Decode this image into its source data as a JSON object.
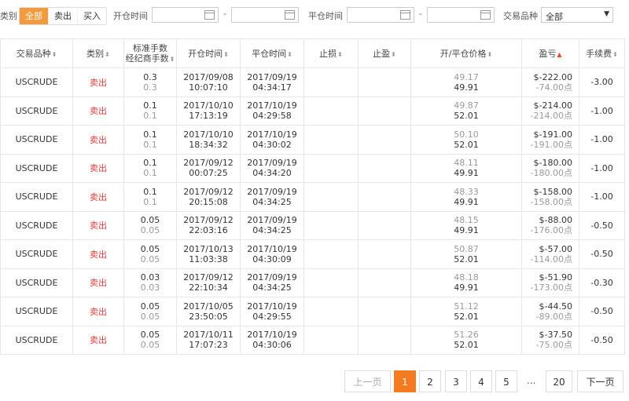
{
  "filters": {
    "type_label": "类别",
    "type_options": [
      "全部",
      "卖出",
      "买入"
    ],
    "open_time_label": "开仓时间",
    "close_time_label": "平仓时间",
    "date_separator": "-",
    "product_label": "交易品种",
    "product_selected": "全部",
    "select_arrow": "▼"
  },
  "table": {
    "headers": {
      "product": "交易品种",
      "type": "类别",
      "lots_line1": "标准手数",
      "lots_line2": "经纪商手数",
      "open_time": "开仓时间",
      "close_time": "平仓时间",
      "stop_loss": "止损",
      "take_profit": "止盈",
      "price": "开/平仓价格",
      "pnl": "盈亏",
      "fee": "手续费"
    },
    "rows": [
      {
        "product": "USCRUDE",
        "type": "卖出",
        "lots": "0.3",
        "broker_lots": "0.3",
        "open_date": "2017/09/08",
        "open_clock": "10:07:10",
        "close_date": "2017/09/19",
        "close_clock": "04:34:17",
        "sl": "",
        "tp": "",
        "open_price": "49.17",
        "close_price": "49.91",
        "pnl": "$-222.00",
        "pnl_points": "-74.00点",
        "fee": "-3.00"
      },
      {
        "product": "USCRUDE",
        "type": "卖出",
        "lots": "0.1",
        "broker_lots": "0.1",
        "open_date": "2017/10/10",
        "open_clock": "17:13:19",
        "close_date": "2017/10/19",
        "close_clock": "04:29:58",
        "sl": "",
        "tp": "",
        "open_price": "49.87",
        "close_price": "52.01",
        "pnl": "$-214.00",
        "pnl_points": "-214.00点",
        "fee": "-1.00"
      },
      {
        "product": "USCRUDE",
        "type": "卖出",
        "lots": "0.1",
        "broker_lots": "0.1",
        "open_date": "2017/10/10",
        "open_clock": "18:34:32",
        "close_date": "2017/10/19",
        "close_clock": "04:30:02",
        "sl": "",
        "tp": "",
        "open_price": "50.10",
        "close_price": "52.01",
        "pnl": "$-191.00",
        "pnl_points": "-191.00点",
        "fee": "-1.00"
      },
      {
        "product": "USCRUDE",
        "type": "卖出",
        "lots": "0.1",
        "broker_lots": "0.1",
        "open_date": "2017/09/12",
        "open_clock": "00:07:25",
        "close_date": "2017/09/19",
        "close_clock": "04:34:20",
        "sl": "",
        "tp": "",
        "open_price": "48.11",
        "close_price": "49.91",
        "pnl": "$-180.00",
        "pnl_points": "-180.00点",
        "fee": "-1.00"
      },
      {
        "product": "USCRUDE",
        "type": "卖出",
        "lots": "0.1",
        "broker_lots": "0.1",
        "open_date": "2017/09/12",
        "open_clock": "20:15:08",
        "close_date": "2017/09/19",
        "close_clock": "04:34:25",
        "sl": "",
        "tp": "",
        "open_price": "48.33",
        "close_price": "49.91",
        "pnl": "$-158.00",
        "pnl_points": "-158.00点",
        "fee": "-1.00"
      },
      {
        "product": "USCRUDE",
        "type": "卖出",
        "lots": "0.05",
        "broker_lots": "0.05",
        "open_date": "2017/09/12",
        "open_clock": "22:03:16",
        "close_date": "2017/09/19",
        "close_clock": "04:34:25",
        "sl": "",
        "tp": "",
        "open_price": "48.15",
        "close_price": "49.91",
        "pnl": "$-88.00",
        "pnl_points": "-176.00点",
        "fee": "-0.50"
      },
      {
        "product": "USCRUDE",
        "type": "卖出",
        "lots": "0.05",
        "broker_lots": "0.05",
        "open_date": "2017/10/13",
        "open_clock": "11:03:38",
        "close_date": "2017/10/19",
        "close_clock": "04:30:09",
        "sl": "",
        "tp": "",
        "open_price": "50.87",
        "close_price": "52.01",
        "pnl": "$-57.00",
        "pnl_points": "-114.00点",
        "fee": "-0.50"
      },
      {
        "product": "USCRUDE",
        "type": "卖出",
        "lots": "0.03",
        "broker_lots": "0.03",
        "open_date": "2017/09/12",
        "open_clock": "22:10:34",
        "close_date": "2017/09/19",
        "close_clock": "04:34:25",
        "sl": "",
        "tp": "",
        "open_price": "48.18",
        "close_price": "49.91",
        "pnl": "$-51.90",
        "pnl_points": "-173.00点",
        "fee": "-0.30"
      },
      {
        "product": "USCRUDE",
        "type": "卖出",
        "lots": "0.05",
        "broker_lots": "0.05",
        "open_date": "2017/10/05",
        "open_clock": "23:50:05",
        "close_date": "2017/10/19",
        "close_clock": "04:29:55",
        "sl": "",
        "tp": "",
        "open_price": "51.12",
        "close_price": "52.01",
        "pnl": "$-44.50",
        "pnl_points": "-89.00点",
        "fee": "-0.50"
      },
      {
        "product": "USCRUDE",
        "type": "卖出",
        "lots": "0.05",
        "broker_lots": "0.05",
        "open_date": "2017/10/11",
        "open_clock": "17:07:23",
        "close_date": "2017/10/19",
        "close_clock": "04:30:06",
        "sl": "",
        "tp": "",
        "open_price": "51.26",
        "close_price": "52.01",
        "pnl": "$-37.50",
        "pnl_points": "-75.00点",
        "fee": "-0.50"
      }
    ]
  },
  "pagination": {
    "prev_label": "上一页",
    "pages": [
      "1",
      "2",
      "3",
      "4",
      "5"
    ],
    "ellipsis": "...",
    "last_page": "20",
    "next_label": "下一页",
    "current": "1"
  },
  "icons": {
    "sort": "⬍",
    "sort_up": "▲"
  }
}
